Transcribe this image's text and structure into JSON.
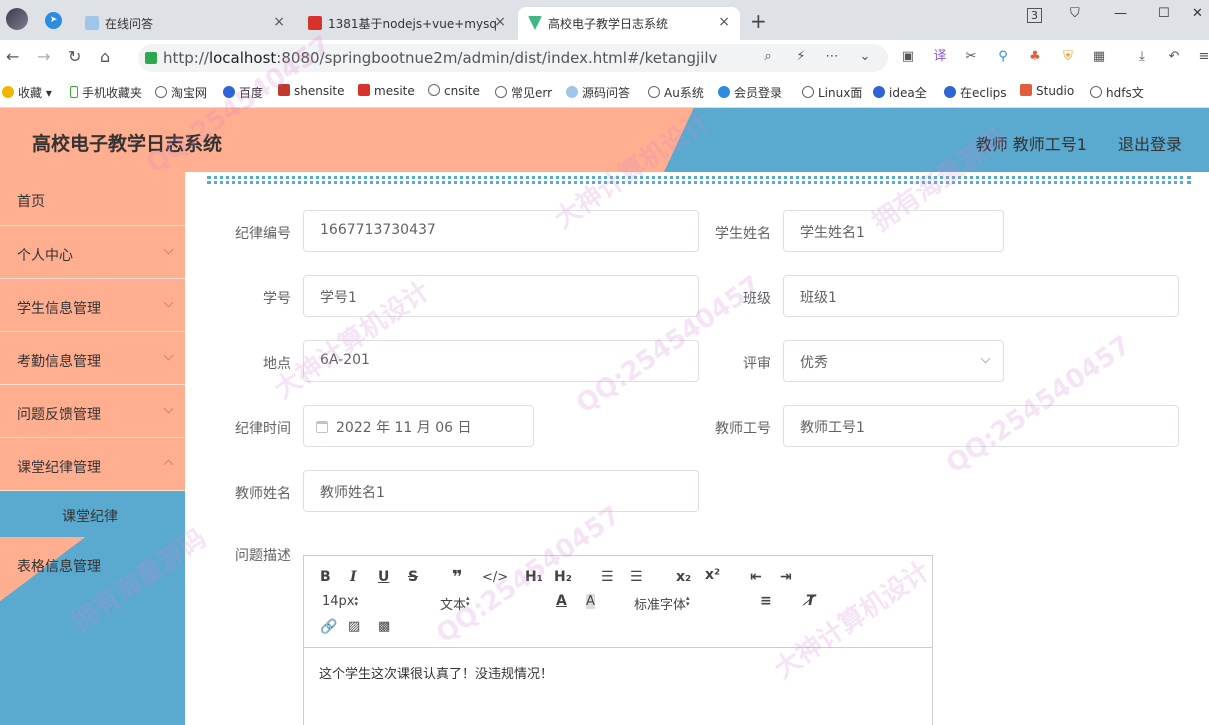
{
  "browser": {
    "tabs": [
      {
        "label": "在线问答",
        "active": false
      },
      {
        "label": "1381基于nodejs+vue+mysq",
        "active": false
      },
      {
        "label": "高校电子教学日志系统",
        "active": true
      }
    ],
    "url_prefix": "http://",
    "url_host": "localhost",
    "url_rest": ":8080/springbootnue2m/admin/dist/index.html#/ketangjilv",
    "tab_count": "3",
    "bookmarks": [
      "收藏",
      "手机收藏夹",
      "淘宝网",
      "百度",
      "shensite",
      "mesite",
      "cnsite",
      "常见err",
      "源码问答",
      "Au系统",
      "会员登录",
      "Linux面",
      "idea全",
      "在eclips",
      "Studio",
      "hdfs文"
    ]
  },
  "app": {
    "title": "高校电子教学日志系统",
    "user": "教师 教师工号1",
    "logout": "退出登录"
  },
  "sidebar": {
    "items": [
      {
        "label": "首页",
        "has_children": false
      },
      {
        "label": "个人中心",
        "has_children": true
      },
      {
        "label": "学生信息管理",
        "has_children": true
      },
      {
        "label": "考勤信息管理",
        "has_children": true
      },
      {
        "label": "问题反馈管理",
        "has_children": true
      },
      {
        "label": "课堂纪律管理",
        "has_children": true,
        "expanded": true,
        "sub": "课堂纪律"
      },
      {
        "label": "表格信息管理",
        "has_children": false
      }
    ]
  },
  "form": {
    "labels": {
      "jilvbianhao": "纪律编号",
      "xueshengxingming": "学生姓名",
      "xuehao": "学号",
      "banji": "班级",
      "didian": "地点",
      "pingshen": "评审",
      "jilvshijian": "纪律时间",
      "jiaoshigonghao": "教师工号",
      "jiaoshixingming": "教师姓名",
      "wentimiaoshu": "问题描述"
    },
    "values": {
      "jilvbianhao": "1667713730437",
      "xueshengxingming": "学生姓名1",
      "xuehao": "学号1",
      "banji": "班级1",
      "didian": "6A-201",
      "pingshen": "优秀",
      "jilvshijian": "2022 年 11 月 06 日",
      "jiaoshigonghao": "教师工号1",
      "jiaoshixingming": "教师姓名1"
    }
  },
  "editor": {
    "font_size": "14px",
    "block_type": "文本",
    "font_family": "标准字体",
    "content": "这个学生这次课很认真了！没违规情况！"
  },
  "watermark": [
    "QQ:254540457",
    "大神计算机设计",
    "拥有海量源码"
  ]
}
